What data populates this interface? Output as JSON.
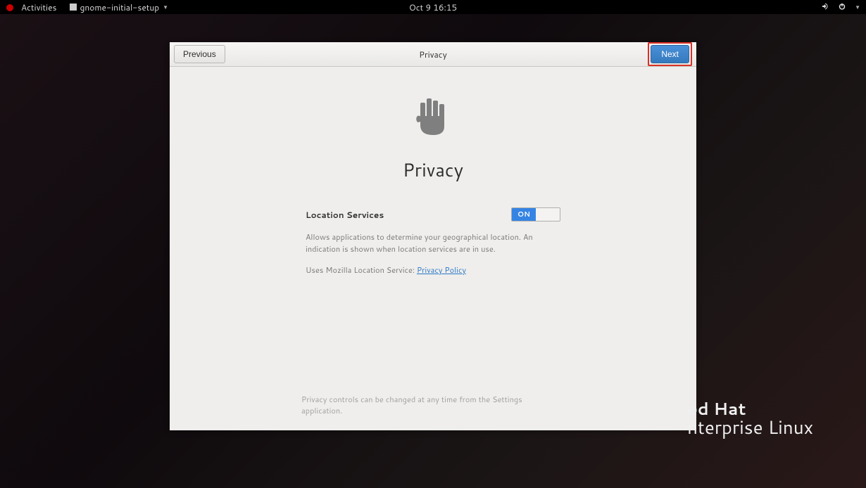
{
  "topbar": {
    "activities": "Activities",
    "app_name": "gnome-initial-setup",
    "datetime": "Oct 9 16:15"
  },
  "dialog": {
    "previous_label": "Previous",
    "header_title": "Privacy",
    "next_label": "Next",
    "page_title": "Privacy",
    "location_services_label": "Location Services",
    "toggle_state": "ON",
    "location_desc": "Allows applications to determine your geographical location. An indication is shown when location services are in use.",
    "mozilla_prefix": "Uses Mozilla Location Service: ",
    "privacy_link": "Privacy Policy",
    "footer": "Privacy controls can be changed at any time from the Settings application."
  },
  "brand": {
    "line1": "ed Hat",
    "line2": "nterprise Linux"
  }
}
